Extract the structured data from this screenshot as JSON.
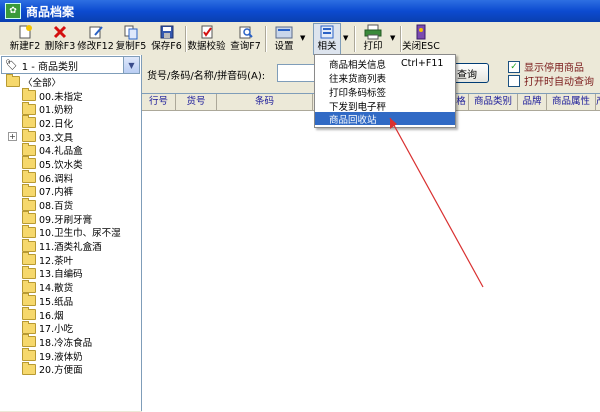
{
  "window": {
    "title": "商品档案",
    "icon": "app-icon"
  },
  "toolbar": {
    "buttons": [
      {
        "label": "新建F2",
        "icon": "new-icon"
      },
      {
        "label": "删除F3",
        "icon": "delete-icon"
      },
      {
        "label": "修改F12",
        "icon": "edit-icon"
      },
      {
        "label": "复制F5",
        "icon": "copy-icon"
      },
      {
        "label": "保存F6",
        "icon": "save-icon"
      },
      {
        "label": "数据校验",
        "icon": "validate-icon"
      },
      {
        "label": "查询F7",
        "icon": "query-icon"
      },
      {
        "label": "设置",
        "icon": "settings-icon"
      },
      {
        "label": "相关",
        "icon": "related-icon"
      },
      {
        "label": "打印",
        "icon": "print-icon"
      },
      {
        "label": "关闭ESC",
        "icon": "close-icon"
      }
    ]
  },
  "category_combo": {
    "value": "1 - 商品类别",
    "icon": "tag-icon"
  },
  "tree": {
    "root": "〈全部〉",
    "items": [
      "00.未指定",
      "01.奶粉",
      "02.日化",
      "03.文具",
      "04.礼品盒",
      "05.饮水类",
      "06.调料",
      "07.内裤",
      "08.百货",
      "09.牙刷牙膏",
      "10.卫生巾、尿不湿",
      "11.酒类礼盒酒",
      "12.茶叶",
      "13.自编码",
      "14.散货",
      "15.纸品",
      "16.烟",
      "17.小吃",
      "18.冷冻食品",
      "19.液体奶",
      "20.方便面"
    ]
  },
  "search": {
    "label": "货号/条码/名称/拼音码(A):",
    "value": "",
    "query_button": "查询"
  },
  "options": {
    "show_disabled": {
      "label": "显示停用商品",
      "checked": true
    },
    "auto_query": {
      "label": "打开时自动查询",
      "checked": false
    }
  },
  "grid": {
    "columns": [
      "行号",
      "货号",
      "条码",
      "",
      "格",
      "商品类别",
      "品牌",
      "商品属性",
      "产"
    ]
  },
  "related_menu": {
    "items": [
      {
        "label": "商品相关信息",
        "shortcut": "Ctrl+F11"
      },
      {
        "label": "往来货商列表",
        "shortcut": ""
      },
      {
        "label": "打印条码标签",
        "shortcut": ""
      },
      {
        "label": "下发到电子秤",
        "shortcut": ""
      },
      {
        "label": "商品回收站",
        "shortcut": "",
        "selected": true
      }
    ]
  },
  "annotation_color": "#d93030"
}
